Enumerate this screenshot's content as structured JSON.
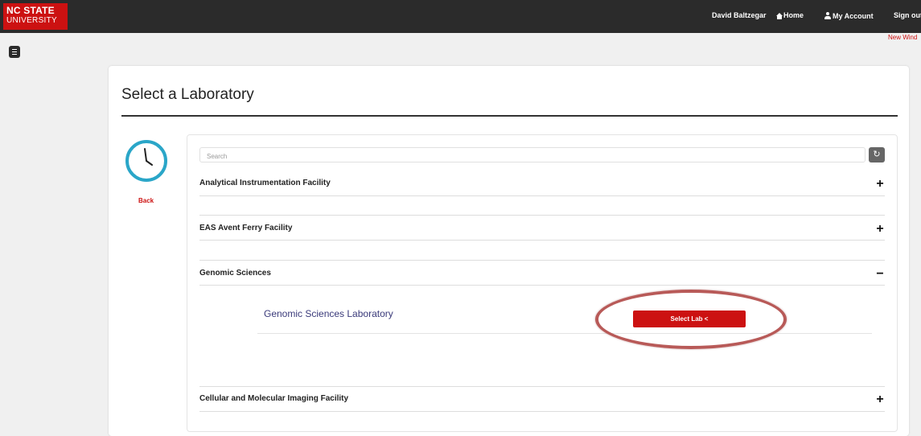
{
  "header": {
    "logo": {
      "line1": "NC STATE",
      "line2": "UNIVERSITY"
    },
    "user_name": "David Baltzegar",
    "home_label": "Home",
    "account_label": "My Account",
    "signout_label": "Sign out",
    "new_window": "New Wind"
  },
  "page": {
    "title": "Select a Laboratory",
    "back_label": "Back"
  },
  "search": {
    "placeholder": "Search",
    "refresh_icon": "refresh-icon"
  },
  "sections": [
    {
      "title": "Analytical Instrumentation Facility",
      "toggle": "+",
      "expanded": false
    },
    {
      "title": "EAS Avent Ferry Facility",
      "toggle": "+",
      "expanded": false
    },
    {
      "title": "Genomic Sciences",
      "toggle": "−",
      "expanded": true,
      "labs": [
        {
          "name": "Genomic Sciences Laboratory",
          "button": "Select Lab  <"
        }
      ]
    },
    {
      "title": "Cellular and Molecular Imaging Facility",
      "toggle": "+",
      "expanded": false
    }
  ],
  "colors": {
    "brand_red": "#cc1111",
    "topbar": "#2b2b2b",
    "clock": "#2aa6c8",
    "highlight": "#b85a58"
  }
}
